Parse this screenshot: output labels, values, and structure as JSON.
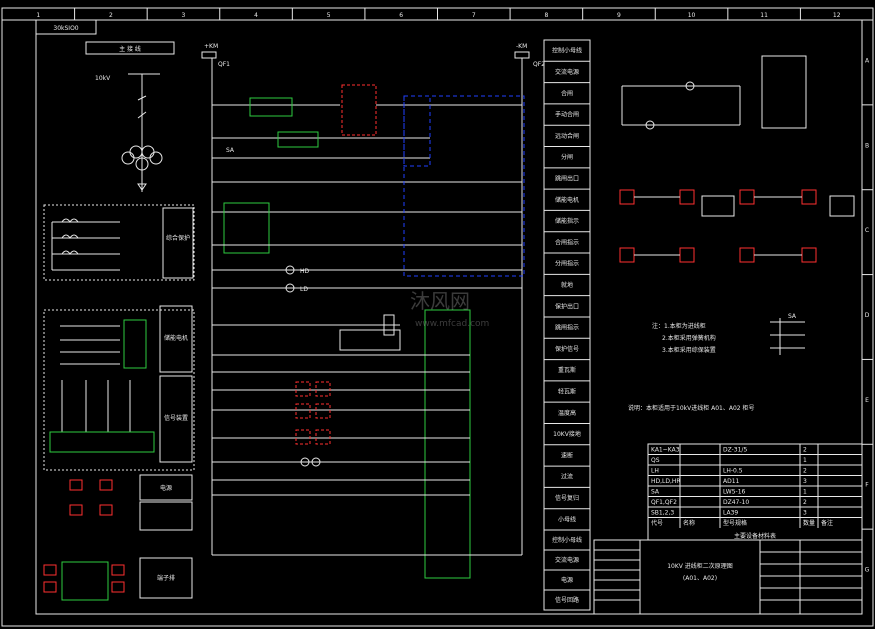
{
  "columns": [
    "1",
    "2",
    "3",
    "4",
    "5",
    "6",
    "7",
    "8",
    "9",
    "10",
    "11",
    "12"
  ],
  "rows": [
    "A",
    "B",
    "C",
    "D",
    "E",
    "F",
    "G"
  ],
  "drawing_no_small": "30kSIO0",
  "main_wiring_title": "主 接 线",
  "voltage_label": "10kV",
  "control_bus_top_left": "+KM",
  "control_bus_top_right": "-KM",
  "right_header_cells": [
    "控制小母线",
    "交流电源",
    "合闸",
    "手动合闸",
    "远动合闸",
    "分闸",
    "跳闸出口",
    "储能电机",
    "储能指示",
    "合闸指示",
    "分闸指示",
    "就地",
    "保护出口",
    "跳闸指示",
    "保护信号",
    "重瓦斯",
    "轻瓦斯",
    "温度高",
    "10KV接地",
    "速断",
    "过流",
    "信号复归",
    "小母线"
  ],
  "right_bottom_cells": [
    "控制小母线",
    "交流电源",
    "电源",
    "信号回路"
  ],
  "notes": [
    "注：1.本柜为进线柜",
    "2.本柜采用弹簧机构",
    "3.本柜采用综保装置"
  ],
  "note_line2": "说明：本柜适用于10kV进线柜 A01、A02 柜号",
  "sa_label": "SA",
  "table_rows": [
    [
      "KA1~KA3",
      "",
      "DZ-31/5",
      "2",
      ""
    ],
    [
      "QS",
      "",
      "",
      "1",
      ""
    ],
    [
      "LH",
      "",
      "LH-0.5",
      "2",
      ""
    ],
    [
      "HD,LD,HR",
      "",
      "AD11",
      "3",
      ""
    ],
    [
      "SA",
      "",
      "LW5-16",
      "1",
      ""
    ],
    [
      "QF1,QF2",
      "",
      "DZ47-10",
      "2",
      ""
    ],
    [
      "SB1,2,3",
      "",
      "LA39",
      "3",
      ""
    ],
    [
      "代号",
      "名称",
      "型号规格",
      "数量",
      "备注"
    ]
  ],
  "table_caption": "主要设备材料表",
  "title_block_name": "10KV 进线柜二次原理图",
  "title_block_sub": "(A01、A02)",
  "labels": {
    "qf1": "QF1",
    "qf2": "QF2",
    "sa_switch": "SA",
    "hd": "HD",
    "ld": "LD",
    "hr": "HR",
    "km": "KM",
    "yr": "YR",
    "yc": "YC",
    "kt": "KT"
  },
  "watermark": "沐风网",
  "watermark_url": "www.mfcad.com",
  "small_boxes": [
    "综合保护",
    "储能电机",
    "信号装置",
    "电源",
    "端子排"
  ],
  "colors": {
    "background": "#000000",
    "line": "#e8e8e8",
    "red": "#ff3030",
    "green": "#2ecc40",
    "blue": "#2040ff",
    "yellow": "#e8d800"
  }
}
